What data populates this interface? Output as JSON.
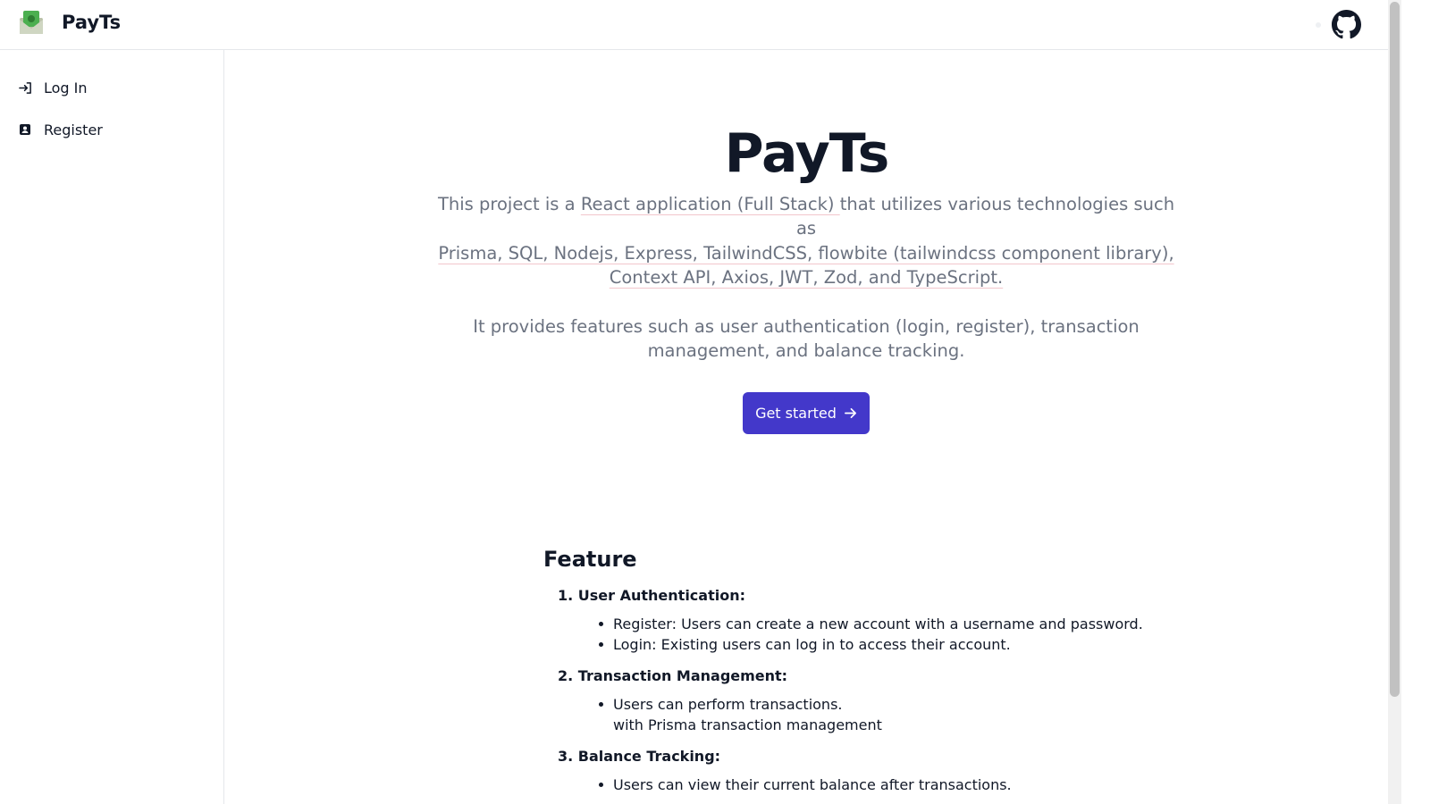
{
  "header": {
    "brand": "PayTs",
    "logo_icon": "money-envelope-icon",
    "github_icon": "github-icon"
  },
  "sidebar": {
    "items": [
      {
        "label": "Log In",
        "icon": "login-icon"
      },
      {
        "label": "Register",
        "icon": "user-badge-icon"
      }
    ]
  },
  "hero": {
    "title": "PayTs",
    "p1_before": "This project is a ",
    "p1_link": "React application (Full Stack) ",
    "p1_after": "that utilizes various technologies such as",
    "p2_link": "Prisma, SQL, Nodejs, Express, TailwindCSS, flowbite (tailwindcss component library), Context API, Axios, JWT, Zod, and TypeScript.",
    "p3": "It provides features such as user authentication (login, register), transaction management, and balance tracking.",
    "cta_label": "Get started",
    "cta_icon": "arrow-right-icon"
  },
  "features": {
    "title": "Feature",
    "sections": [
      {
        "heading": "1. User Authentication:",
        "items": [
          "Register: Users can create a new account with a username and password.",
          "Login: Existing users can log in to access their account."
        ]
      },
      {
        "heading": "2. Transaction Management:",
        "items": [
          "Users can perform transactions.",
          "with Prisma transaction management"
        ]
      },
      {
        "heading": "3. Balance Tracking:",
        "items": [
          "Users can view their current balance after transactions."
        ]
      }
    ]
  },
  "colors": {
    "accent": "#4338ca",
    "muted_text": "#6b7280",
    "border": "#e5e7eb"
  }
}
